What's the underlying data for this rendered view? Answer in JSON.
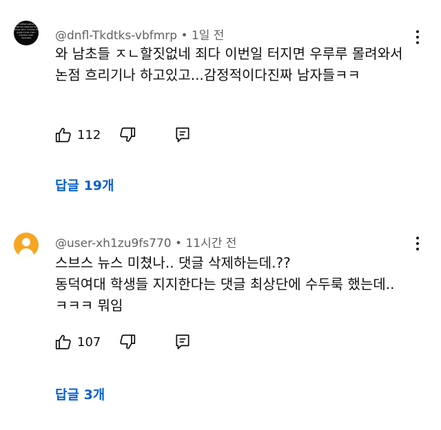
{
  "comments": [
    {
      "avatar_text": "My hottest places in hell are reserved for those who, in times of great moral crisis, maintain their neutrality",
      "avatar_color": "#0a0a0a",
      "author": "@dnfl-Tkdtks-vbfmrp",
      "time": "1일 전",
      "text": "와 남초들 ㅈㄴ할짓없네 죄다 이번일 터지면 우루루 몰려와서 논점 흐리기나 하고있고...감정적이다진짜 남자들ㅋㅋ",
      "likes": "112",
      "replies_label": "답글 19개"
    },
    {
      "avatar_color": "#f6a623",
      "author": "@user-xh1zu9fs770",
      "time": "11시간 전",
      "text": "스브스 뉴스 미쳤나.. 댓글 삭제하는데.??\n동덕여대 학생들 지지한다는 댓글 최상단에 수두룩 했는데..ㅋㅋㅋ 뭐임",
      "likes": "107",
      "replies_label": "답글 3개"
    }
  ],
  "meta_separator": " • ",
  "link_color": "#065fd4",
  "icons": [
    "like-icon",
    "dislike-icon",
    "reply-icon",
    "more-options-icon"
  ]
}
